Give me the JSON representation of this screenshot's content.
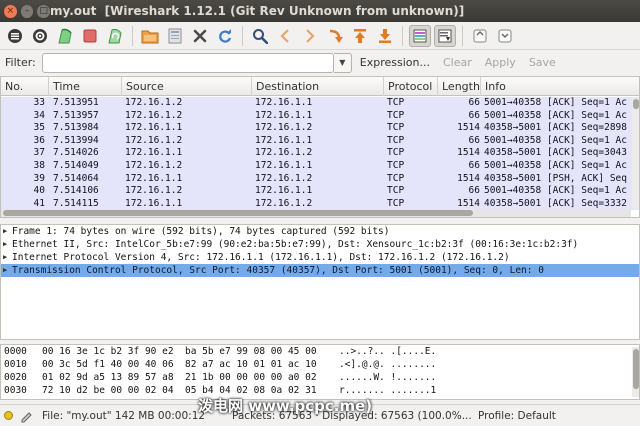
{
  "window": {
    "title": "my.out  [Wireshark 1.12.1 (Git Rev Unknown from unknown)]",
    "close_glyph": "×",
    "min_glyph": "–",
    "max_glyph": "□"
  },
  "toolbar": {
    "icons": [
      "interface-list-icon",
      "capture-options-icon",
      "start-capture-icon",
      "stop-capture-icon",
      "restart-capture-icon",
      "open-file-icon",
      "save-file-icon",
      "close-file-icon",
      "reload-icon",
      "find-packet-icon",
      "go-back-icon",
      "go-forward-icon",
      "go-to-packet-icon",
      "go-first-icon",
      "go-last-icon",
      "colorize-icon",
      "auto-scroll-icon",
      "zoom-in-icon",
      "zoom-out-icon"
    ]
  },
  "filter": {
    "label": "Filter:",
    "value": "",
    "expression_label": "Expression...",
    "clear_label": "Clear",
    "apply_label": "Apply",
    "save_label": "Save"
  },
  "packet_list": {
    "columns": [
      "No.",
      "Time",
      "Source",
      "Destination",
      "Protocol",
      "Length",
      "Info"
    ],
    "rows": [
      {
        "no": "33",
        "time": "7.513951",
        "src": "172.16.1.2",
        "dst": "172.16.1.1",
        "proto": "TCP",
        "len": "66",
        "info": "5001→40358 [ACK] Seq=1 Ac"
      },
      {
        "no": "34",
        "time": "7.513957",
        "src": "172.16.1.2",
        "dst": "172.16.1.1",
        "proto": "TCP",
        "len": "66",
        "info": "5001→40358 [ACK] Seq=1 Ac"
      },
      {
        "no": "35",
        "time": "7.513984",
        "src": "172.16.1.1",
        "dst": "172.16.1.2",
        "proto": "TCP",
        "len": "1514",
        "info": "40358→5001 [ACK] Seq=2898"
      },
      {
        "no": "36",
        "time": "7.513994",
        "src": "172.16.1.2",
        "dst": "172.16.1.1",
        "proto": "TCP",
        "len": "66",
        "info": "5001→40358 [ACK] Seq=1 Ac"
      },
      {
        "no": "37",
        "time": "7.514026",
        "src": "172.16.1.1",
        "dst": "172.16.1.2",
        "proto": "TCP",
        "len": "1514",
        "info": "40358→5001 [ACK] Seq=3043"
      },
      {
        "no": "38",
        "time": "7.514049",
        "src": "172.16.1.2",
        "dst": "172.16.1.1",
        "proto": "TCP",
        "len": "66",
        "info": "5001→40358 [ACK] Seq=1 Ac"
      },
      {
        "no": "39",
        "time": "7.514064",
        "src": "172.16.1.1",
        "dst": "172.16.1.2",
        "proto": "TCP",
        "len": "1514",
        "info": "40358→5001 [PSH, ACK] Seq"
      },
      {
        "no": "40",
        "time": "7.514106",
        "src": "172.16.1.2",
        "dst": "172.16.1.1",
        "proto": "TCP",
        "len": "66",
        "info": "5001→40358 [ACK] Seq=1 Ac"
      },
      {
        "no": "41",
        "time": "7.514115",
        "src": "172.16.1.1",
        "dst": "172.16.1.2",
        "proto": "TCP",
        "len": "1514",
        "info": "40358→5001 [ACK] Seq=3332"
      }
    ]
  },
  "details": {
    "lines": [
      {
        "text": "Frame 1: 74 bytes on wire (592 bits), 74 bytes captured (592 bits)",
        "selected": false
      },
      {
        "text": "Ethernet II, Src: IntelCor_5b:e7:99 (90:e2:ba:5b:e7:99), Dst: Xensourc_1c:b2:3f (00:16:3e:1c:b2:3f)",
        "selected": false
      },
      {
        "text": "Internet Protocol Version 4, Src: 172.16.1.1 (172.16.1.1), Dst: 172.16.1.2 (172.16.1.2)",
        "selected": false
      },
      {
        "text": "Transmission Control Protocol, Src Port: 40357 (40357), Dst Port: 5001 (5001), Seq: 0, Len: 0",
        "selected": true
      }
    ],
    "expander_glyph": "▶"
  },
  "bytes": {
    "rows": [
      {
        "offset": "0000",
        "hex": "00 16 3e 1c b2 3f 90 e2  ba 5b e7 99 08 00 45 00",
        "ascii": "..>..?.. .[....E."
      },
      {
        "offset": "0010",
        "hex": "00 3c 5d f1 40 00 40 06  82 a7 ac 10 01 01 ac 10",
        "ascii": ".<].@.@. ........"
      },
      {
        "offset": "0020",
        "hex": "01 02 9d a5 13 89 57 a8  21 1b 00 00 00 00 a0 02",
        "ascii": "......W. !......."
      },
      {
        "offset": "0030",
        "hex": "72 10 d2 be 00 00 02 04  05 b4 04 02 08 0a 02 31",
        "ascii": "r....... .......1"
      }
    ]
  },
  "status": {
    "file": "File: \"my.out\" 142 MB 00:00:12",
    "packets": "Packets: 67563 · Displayed: 67563 (100.0%...",
    "profile": "Profile: Default",
    "watermark": "泼电网 www.pcpc.me)"
  },
  "colors": {
    "row_bg": "#e4e4fb",
    "selected_bg": "#74aae8",
    "titlebar": "#3c3b37",
    "stop_red": "#d9534f",
    "fin_green": "#4caf50"
  }
}
